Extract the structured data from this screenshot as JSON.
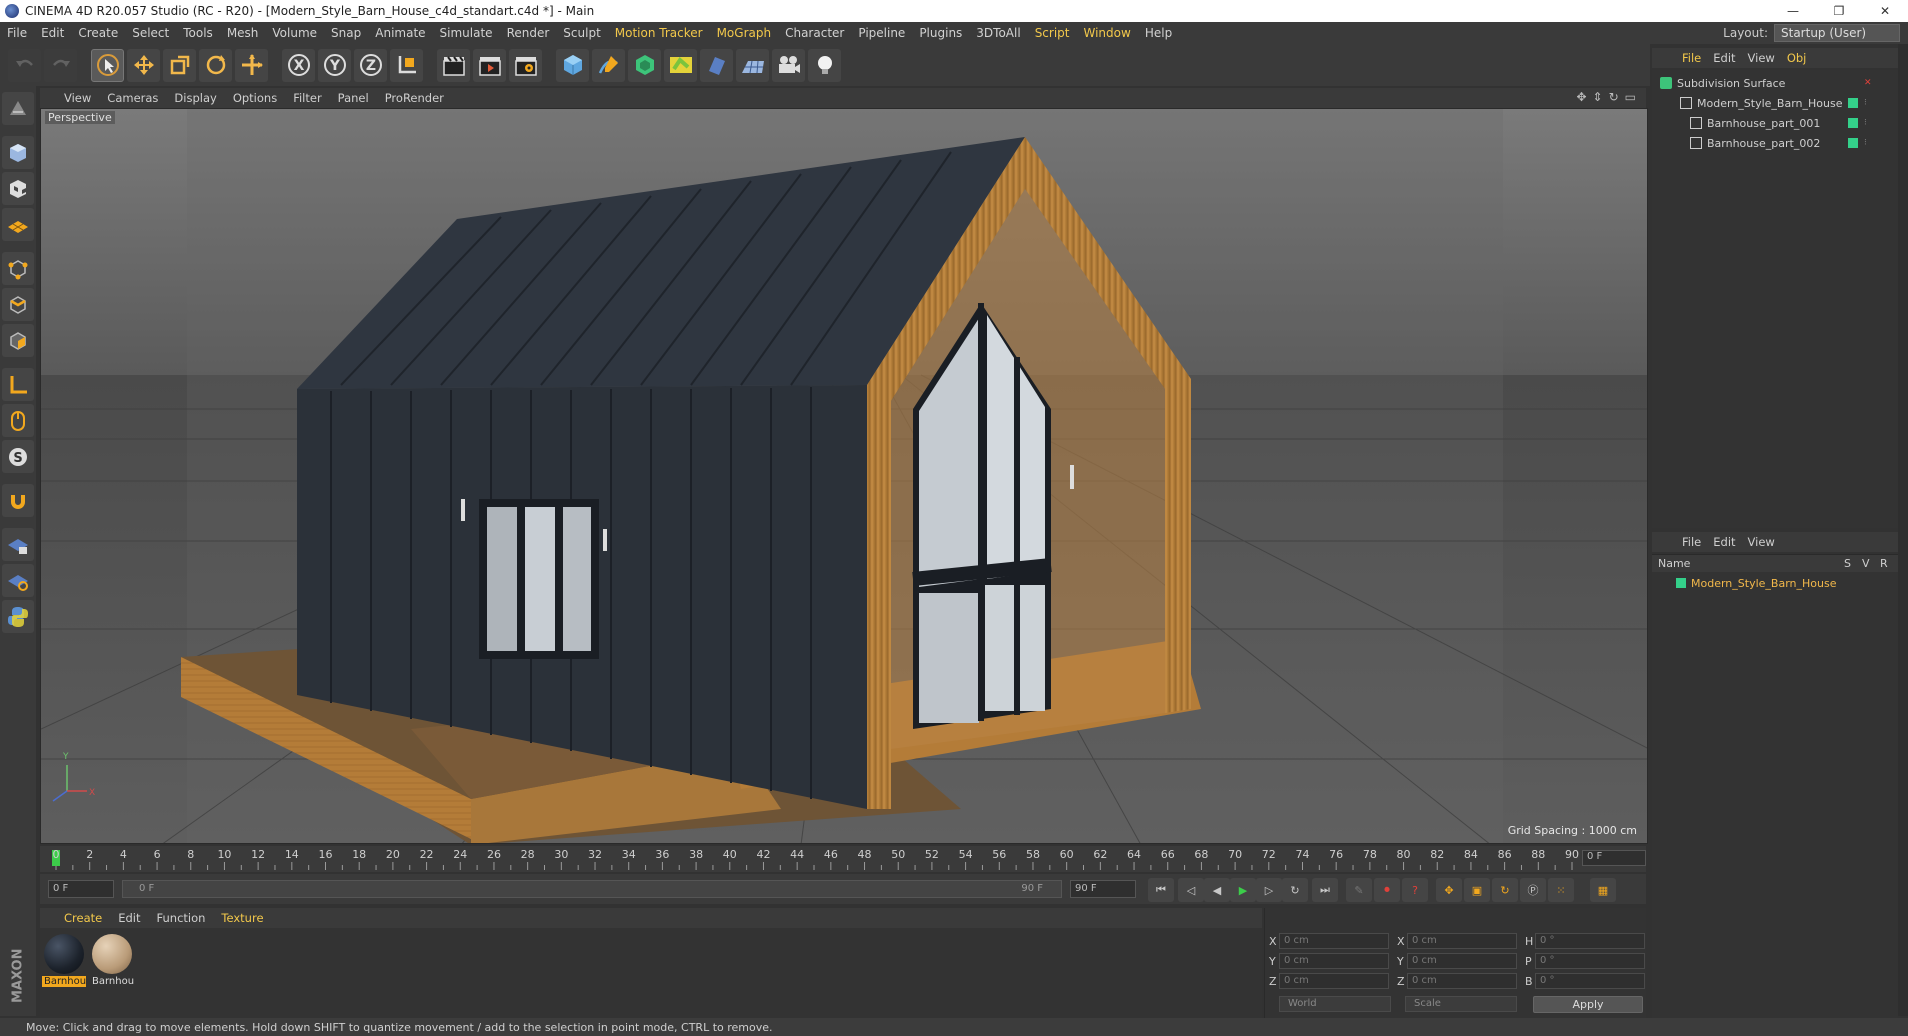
{
  "window": {
    "title": "CINEMA 4D R20.057 Studio (RC - R20) - [Modern_Style_Barn_House_c4d_standart.c4d *] - Main",
    "controls": [
      "—",
      "❐",
      "✕"
    ]
  },
  "menu": {
    "items": [
      "File",
      "Edit",
      "Create",
      "Select",
      "Tools",
      "Mesh",
      "Volume",
      "Snap",
      "Animate",
      "Simulate",
      "Render",
      "Sculpt",
      "Motion Tracker",
      "MoGraph",
      "Character",
      "Pipeline",
      "Plugins",
      "3DToAll",
      "Script",
      "Window",
      "Help"
    ],
    "highlighted": [
      "Motion Tracker",
      "MoGraph",
      "Script"
    ],
    "layout_label": "Layout:",
    "layout_value": "Startup (User)"
  },
  "toolbar": {
    "axis_x": "X",
    "axis_y": "Y",
    "axis_z": "Z"
  },
  "viewport": {
    "menu": [
      "View",
      "Cameras",
      "Display",
      "Options",
      "Filter",
      "Panel",
      "ProRender"
    ],
    "label": "Perspective",
    "grid_spacing": "Grid Spacing : 1000 cm",
    "colors": {
      "wall": "#2b3139",
      "wood": "#b07a36",
      "floor": "#5e5e5e",
      "sky": "#6d6d6d"
    }
  },
  "timeline": {
    "ticks": [
      "0",
      "2",
      "4",
      "6",
      "8",
      "10",
      "12",
      "14",
      "16",
      "18",
      "20",
      "22",
      "24",
      "26",
      "28",
      "30",
      "32",
      "34",
      "36",
      "38",
      "40",
      "42",
      "44",
      "46",
      "48",
      "50",
      "52",
      "54",
      "56",
      "58",
      "60",
      "62",
      "64",
      "66",
      "68",
      "70",
      "72",
      "74",
      "76",
      "78",
      "80",
      "82",
      "84",
      "86",
      "88",
      "90"
    ],
    "current_frame": "0 F",
    "start_field": "0 F",
    "slider_start": "0 F",
    "slider_end": "90 F",
    "end_field": "90 F"
  },
  "materials": {
    "menu": [
      "Create",
      "Edit",
      "Function",
      "Texture"
    ],
    "items": [
      {
        "label": "Barnhou",
        "color": "#1c222b",
        "selected": true
      },
      {
        "label": "Barnhou",
        "color": "#b99b78",
        "selected": false
      }
    ]
  },
  "coordinates": {
    "rows": [
      {
        "a": "X",
        "av": "0 cm",
        "b": "X",
        "bv": "0 cm",
        "c": "H",
        "cv": "0 °"
      },
      {
        "a": "Y",
        "av": "0 cm",
        "b": "Y",
        "bv": "0 cm",
        "c": "P",
        "cv": "0 °"
      },
      {
        "a": "Z",
        "av": "0 cm",
        "b": "Z",
        "bv": "0 cm",
        "c": "B",
        "cv": "0 °"
      }
    ],
    "space": "World",
    "mode": "Scale",
    "apply": "Apply"
  },
  "object_manager": {
    "menu": [
      "File",
      "Edit",
      "View",
      "Obj"
    ],
    "objects": [
      {
        "name": "Subdivision Surface",
        "indent": 0
      },
      {
        "name": "Modern_Style_Barn_House",
        "indent": 1
      },
      {
        "name": "Barnhouse_part_001",
        "indent": 2
      },
      {
        "name": "Barnhouse_part_002",
        "indent": 2
      }
    ]
  },
  "layer_manager": {
    "menu": [
      "File",
      "Edit",
      "View"
    ],
    "columns": [
      "Name",
      "S",
      "V",
      "R"
    ],
    "row": "Modern_Style_Barn_House"
  },
  "status": "Move: Click and drag to move elements. Hold down SHIFT to quantize movement / add to the selection in point mode, CTRL to remove."
}
